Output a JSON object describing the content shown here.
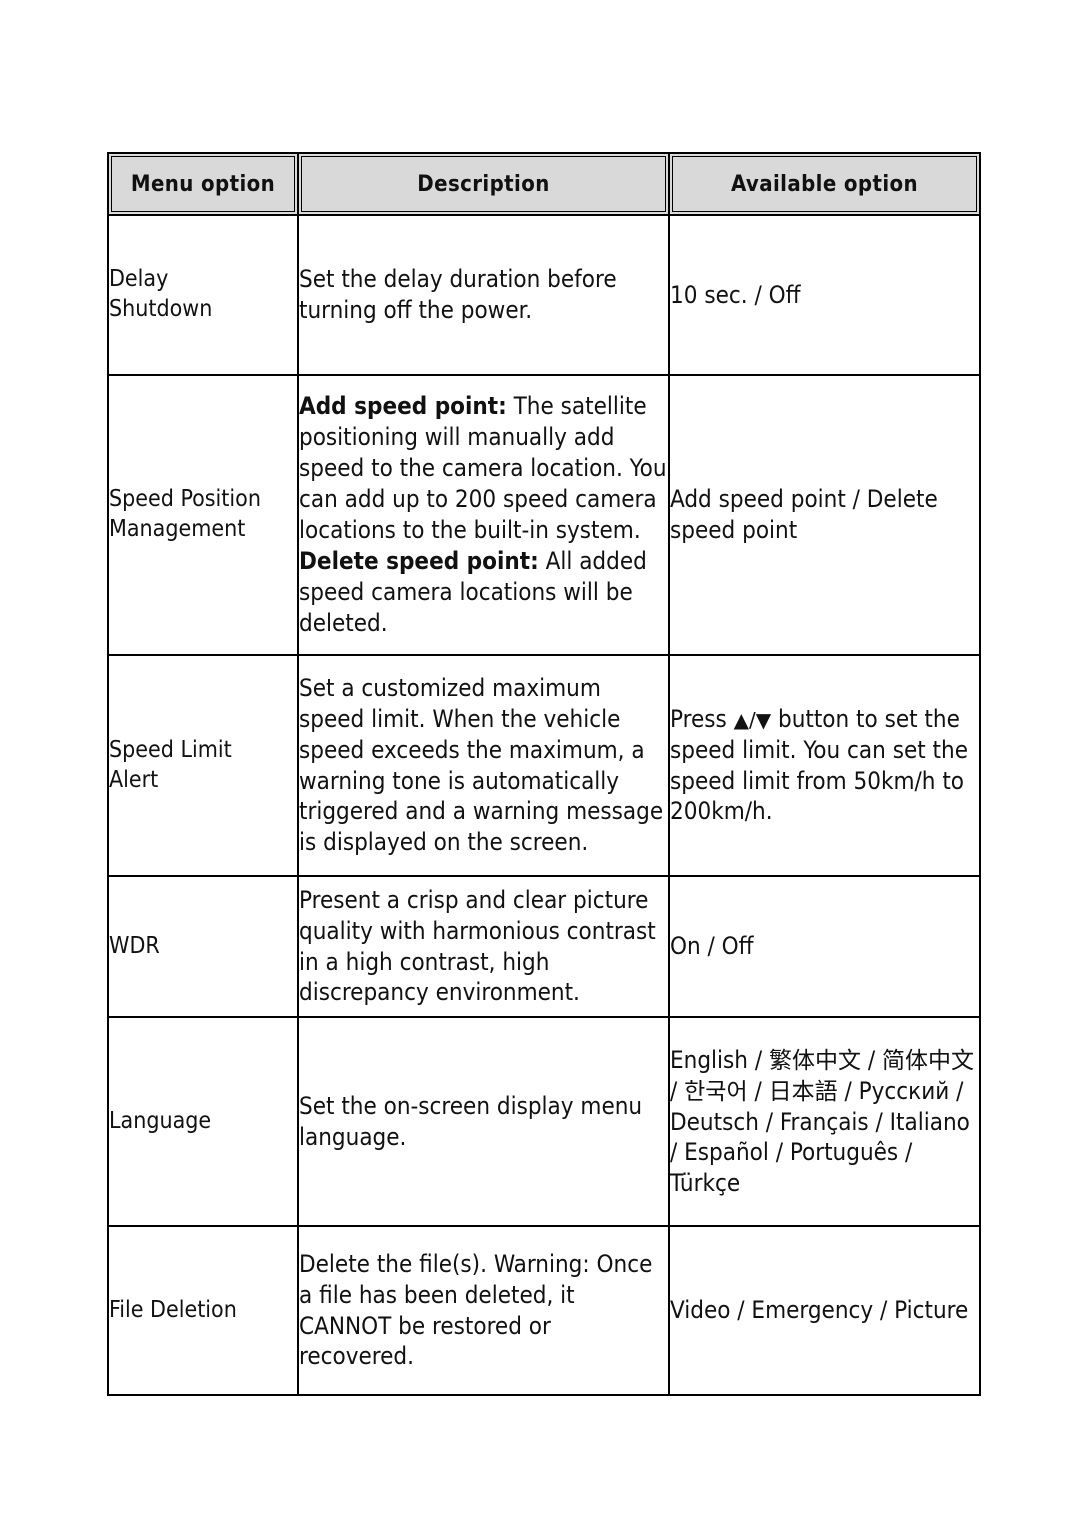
{
  "table": {
    "headers": [
      {
        "label": "Menu option"
      },
      {
        "label": "Description"
      },
      {
        "label": "Available option"
      }
    ],
    "rows": [
      {
        "menu_option": "Delay\nShutdown",
        "menu_option_line1": "Delay",
        "menu_option_line2": "Shutdown",
        "description": "Set the delay duration before turning off the power.",
        "available_option": "10 sec. / Off"
      },
      {
        "menu_option_line1": "Speed Position",
        "menu_option_line2": "Management",
        "description_add_label": "Add speed point:",
        "description_add_text": " The satellite positioning will manually add speed to the camera location. You can add up to 200 speed camera locations to the built-in system.",
        "description_delete_label": "Delete speed point:",
        "description_delete_text": " All added speed camera locations will be deleted.",
        "available_option": "Add speed point / Delete speed point"
      },
      {
        "menu_option_line1": "Speed Limit",
        "menu_option_line2": "Alert",
        "description": "Set a customized maximum speed limit. When the vehicle speed exceeds the maximum, a warning tone is automatically triggered and a warning message is displayed on the screen.",
        "available_option_prefix": "Press ",
        "available_option_up_icon": "▲",
        "available_option_separator": "/",
        "available_option_down_icon": "▼",
        "available_option_suffix": " button to set the speed limit. You can set the speed limit from 50km/h to 200km/h."
      },
      {
        "menu_option_line1": "WDR",
        "menu_option_line2": "",
        "description": "Present a crisp and clear picture quality with harmonious contrast in a high contrast, high discrepancy environment.",
        "available_option": "On / Off"
      },
      {
        "menu_option_line1": "Language",
        "menu_option_line2": "",
        "description": "Set the on-screen display menu language.",
        "available_option_latin_1": "English / ",
        "available_option_cjk_1": "繁体中文",
        "available_option_latin_2": " / ",
        "available_option_cjk_2": "简体中文",
        "available_option_latin_3": " / ",
        "available_option_cjk_3": "한국어",
        "available_option_latin_4": " / ",
        "available_option_cjk_4": "日本語",
        "available_option_latin_5": " / Русский / Deutsch / Français / Italiano / Español / Português / Türkçe"
      },
      {
        "menu_option_line1": "File Deletion",
        "menu_option_line2": "",
        "description": "Delete the file(s).  Warning: Once a file has been deleted, it CANNOT be restored or recovered.",
        "available_option": "Video / Emergency / Picture"
      }
    ]
  },
  "colors": {
    "header_fill": "#d9d9d9",
    "border": "#000000",
    "text": "#111111",
    "page_background": "#ffffff"
  }
}
